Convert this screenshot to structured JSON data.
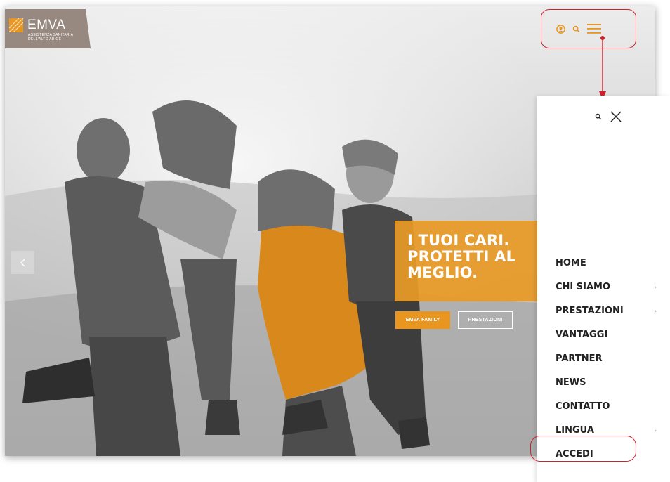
{
  "brand": {
    "name": "EMVA",
    "subtitle_line1": "ASSISTENZA SANITARIA",
    "subtitle_line2": "DELL'ALTO ADIGE"
  },
  "header": {
    "icons": [
      "user-circle-icon",
      "search-icon",
      "hamburger-menu-icon"
    ],
    "accent_color": "#e8961f"
  },
  "hero": {
    "title_line1": "I TUOI CARI.",
    "title_line2": "PROTETTI AL",
    "title_line3": "MEGLIO.",
    "primary_button": "EMVA FAMILY",
    "secondary_button": "PRESTAZIONI",
    "box_color": "#e8961f"
  },
  "menu": {
    "items": [
      {
        "label": "HOME",
        "has_submenu": false
      },
      {
        "label": "CHI SIAMO",
        "has_submenu": true
      },
      {
        "label": "PRESTAZIONI",
        "has_submenu": true
      },
      {
        "label": "VANTAGGI",
        "has_submenu": false
      },
      {
        "label": "PARTNER",
        "has_submenu": false
      },
      {
        "label": "NEWS",
        "has_submenu": false
      },
      {
        "label": "CONTATTO",
        "has_submenu": false
      },
      {
        "label": "LINGUA",
        "has_submenu": true
      },
      {
        "label": "ACCEDI",
        "has_submenu": false
      }
    ],
    "chevron": "›"
  },
  "annotation_color": "#d0202a"
}
